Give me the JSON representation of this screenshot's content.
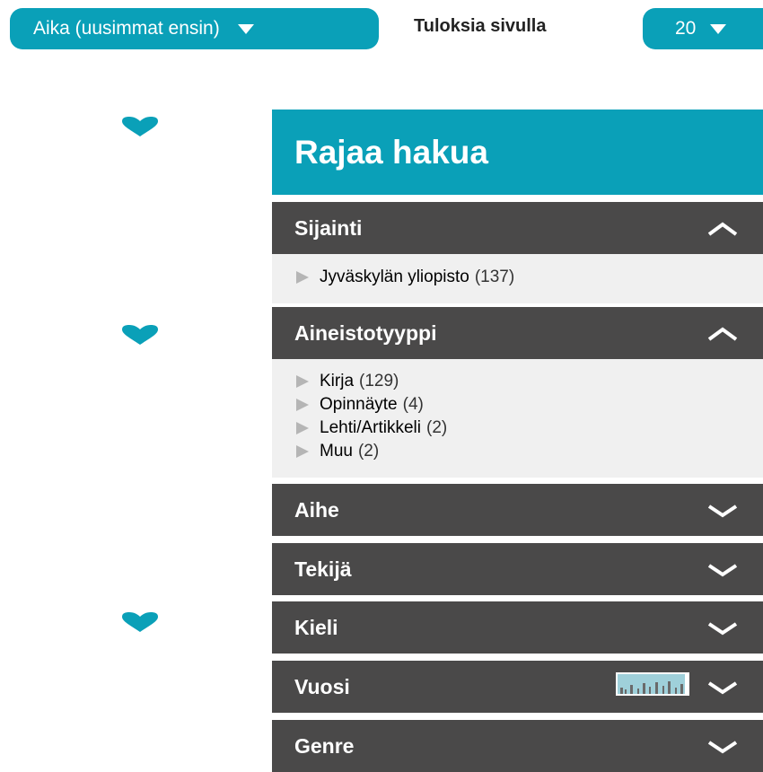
{
  "toolbar": {
    "sort_value": "Aika (uusimmat ensin)",
    "per_page_label": "Tuloksia sivulla",
    "per_page_value": "20"
  },
  "panel": {
    "title": "Rajaa hakua"
  },
  "facets": {
    "sijainti": {
      "label": "Sijainti",
      "items": [
        {
          "label": "Jyväskylän yliopisto",
          "count": "(137)"
        }
      ]
    },
    "aineistotyyppi": {
      "label": "Aineistotyyppi",
      "items": [
        {
          "label": "Kirja",
          "count": "(129)"
        },
        {
          "label": "Opinnäyte",
          "count": "(4)"
        },
        {
          "label": "Lehti/Artikkeli",
          "count": "(2)"
        },
        {
          "label": "Muu",
          "count": "(2)"
        }
      ]
    },
    "aihe": {
      "label": "Aihe"
    },
    "tekija": {
      "label": "Tekijä"
    },
    "kieli": {
      "label": "Kieli"
    },
    "vuosi": {
      "label": "Vuosi"
    },
    "genre": {
      "label": "Genre"
    }
  },
  "colors": {
    "accent": "#0aa0b8",
    "header_bg": "#4a4949",
    "body_bg": "#f0f0f0"
  }
}
